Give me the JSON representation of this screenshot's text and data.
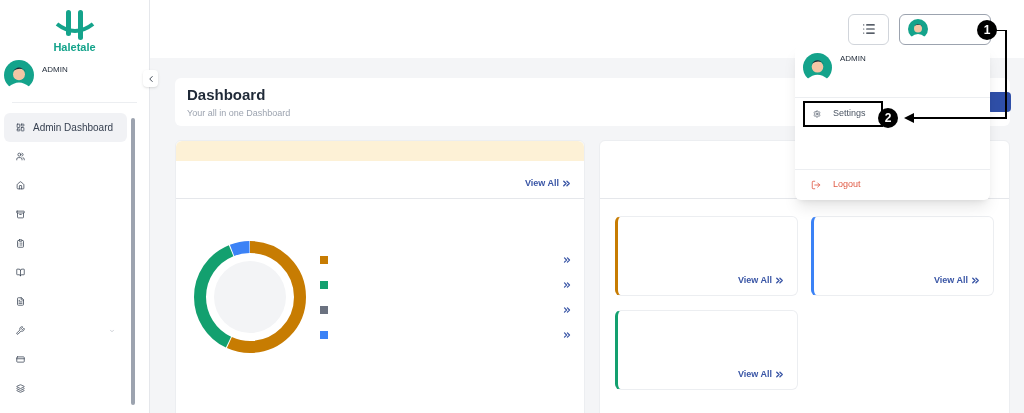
{
  "brand": {
    "name": "Haletale"
  },
  "sidebar": {
    "user": "ADMIN",
    "items": [
      {
        "label": "Admin Dashboard",
        "selected": true,
        "has_submenu": false
      },
      {
        "selected": false,
        "has_submenu": false
      },
      {
        "selected": false,
        "has_submenu": false
      },
      {
        "selected": false,
        "has_submenu": false
      },
      {
        "selected": false,
        "has_submenu": false
      },
      {
        "selected": false,
        "has_submenu": false
      },
      {
        "selected": false,
        "has_submenu": false
      },
      {
        "selected": false,
        "has_submenu": true
      },
      {
        "selected": false,
        "has_submenu": false
      },
      {
        "selected": false,
        "has_submenu": false
      }
    ]
  },
  "page_header": {
    "title": "Dashboard",
    "subtitle": "Your all in one Dashboard"
  },
  "left_panel": {
    "link": "View All",
    "legend": [
      {
        "color": "#c77c02"
      },
      {
        "color": "#13a06f"
      },
      {
        "color": "#6b7280"
      },
      {
        "color": "#3b82f6"
      }
    ]
  },
  "right_panel": {
    "cards": [
      {
        "color": "#c77c02",
        "link": "View All"
      },
      {
        "color": "#3b82f6",
        "link": "View All"
      },
      {
        "color": "#13a06f",
        "link": "View All"
      }
    ]
  },
  "user_menu": {
    "user": "ADMIN",
    "items": [
      {
        "label": "Settings",
        "kind": "normal"
      },
      {
        "label": "Logout",
        "kind": "danger"
      }
    ]
  },
  "annotations": [
    {
      "label": "1"
    },
    {
      "label": "2"
    }
  ]
}
